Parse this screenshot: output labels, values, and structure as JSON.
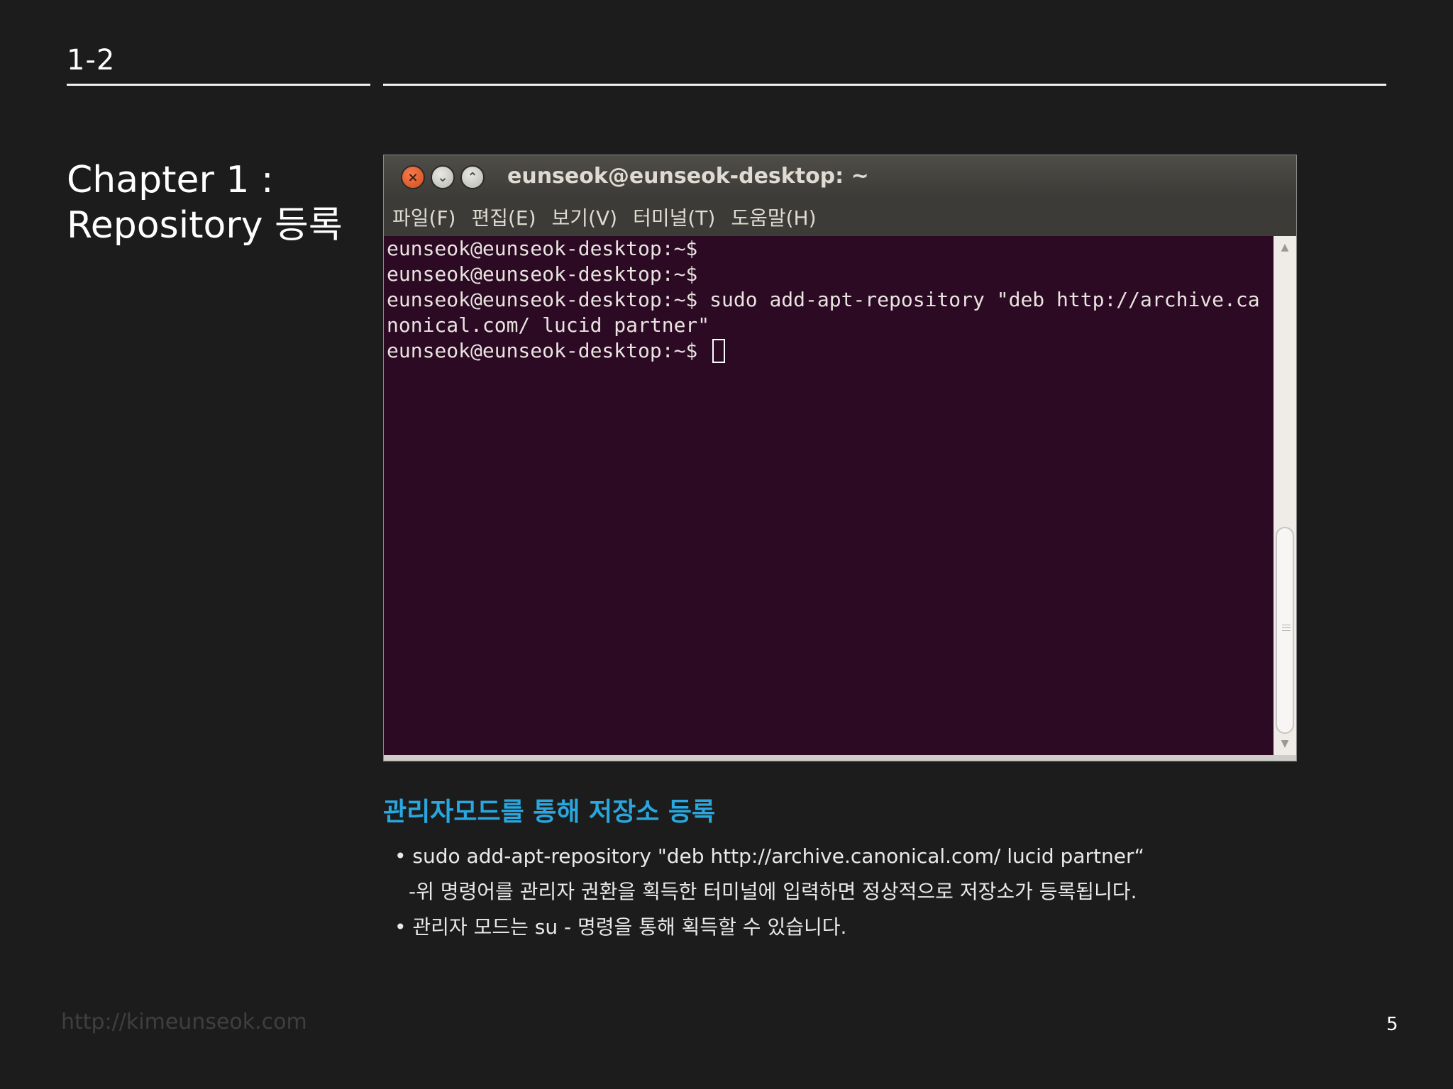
{
  "slide": {
    "section_number": "1-2",
    "chapter_title_line1": "Chapter 1 :",
    "chapter_title_line2": "Repository 등록",
    "footer_url": "http://kimeunseok.com",
    "page_number": "5"
  },
  "terminal": {
    "title": "eunseok@eunseok-desktop: ~",
    "buttons": {
      "close": "×",
      "minimize": "⌄",
      "maximize": "⌃"
    },
    "menu": [
      "파일(F)",
      "편집(E)",
      "보기(V)",
      "터미널(T)",
      "도움말(H)"
    ],
    "lines": [
      "eunseok@eunseok-desktop:~$",
      "eunseok@eunseok-desktop:~$",
      "eunseok@eunseok-desktop:~$ sudo add-apt-repository \"deb http://archive.ca",
      "nonical.com/ lucid partner\"",
      "eunseok@eunseok-desktop:~$ "
    ],
    "scroll_up": "▲",
    "scroll_down": "▼"
  },
  "content": {
    "subheading": "관리자모드를 통해 저장소 등록",
    "bullets": [
      "• sudo add-apt-repository  \"deb http://archive.canonical.com/ lucid partner“",
      "-위 명령어를 관리자 권환을 획득한 터미널에 입력하면 정상적으로 저장소가 등록됩니다.",
      "• 관리자 모드는 su - 명령을 통해 획득할 수 있습니다."
    ]
  },
  "colors": {
    "background": "#1c1c1d",
    "terminal_bg": "#2c0a24",
    "accent": "#29a7de"
  }
}
